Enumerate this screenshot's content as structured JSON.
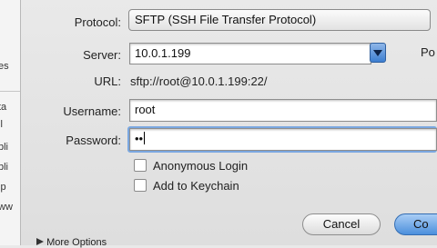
{
  "form": {
    "protocol_label": "Protocol:",
    "protocol_value": "SFTP (SSH File Transfer Protocol)",
    "server_label": "Server:",
    "server_value": "10.0.1.199",
    "port_label_partial": "Po",
    "url_label": "URL:",
    "url_value": "sftp://root@10.0.1.199:22/",
    "username_label": "Username:",
    "username_value": "root",
    "password_label": "Password:",
    "password_value": "••",
    "anonymous_label": "Anonymous Login",
    "keychain_label": "Add to Keychain"
  },
  "buttons": {
    "cancel": "Cancel",
    "connect_partial": "Co"
  },
  "more_options": "More Options",
  "left_fragments": [
    "es",
    "ta",
    "il",
    "bli",
    "bli",
    "ip",
    "ww"
  ]
}
